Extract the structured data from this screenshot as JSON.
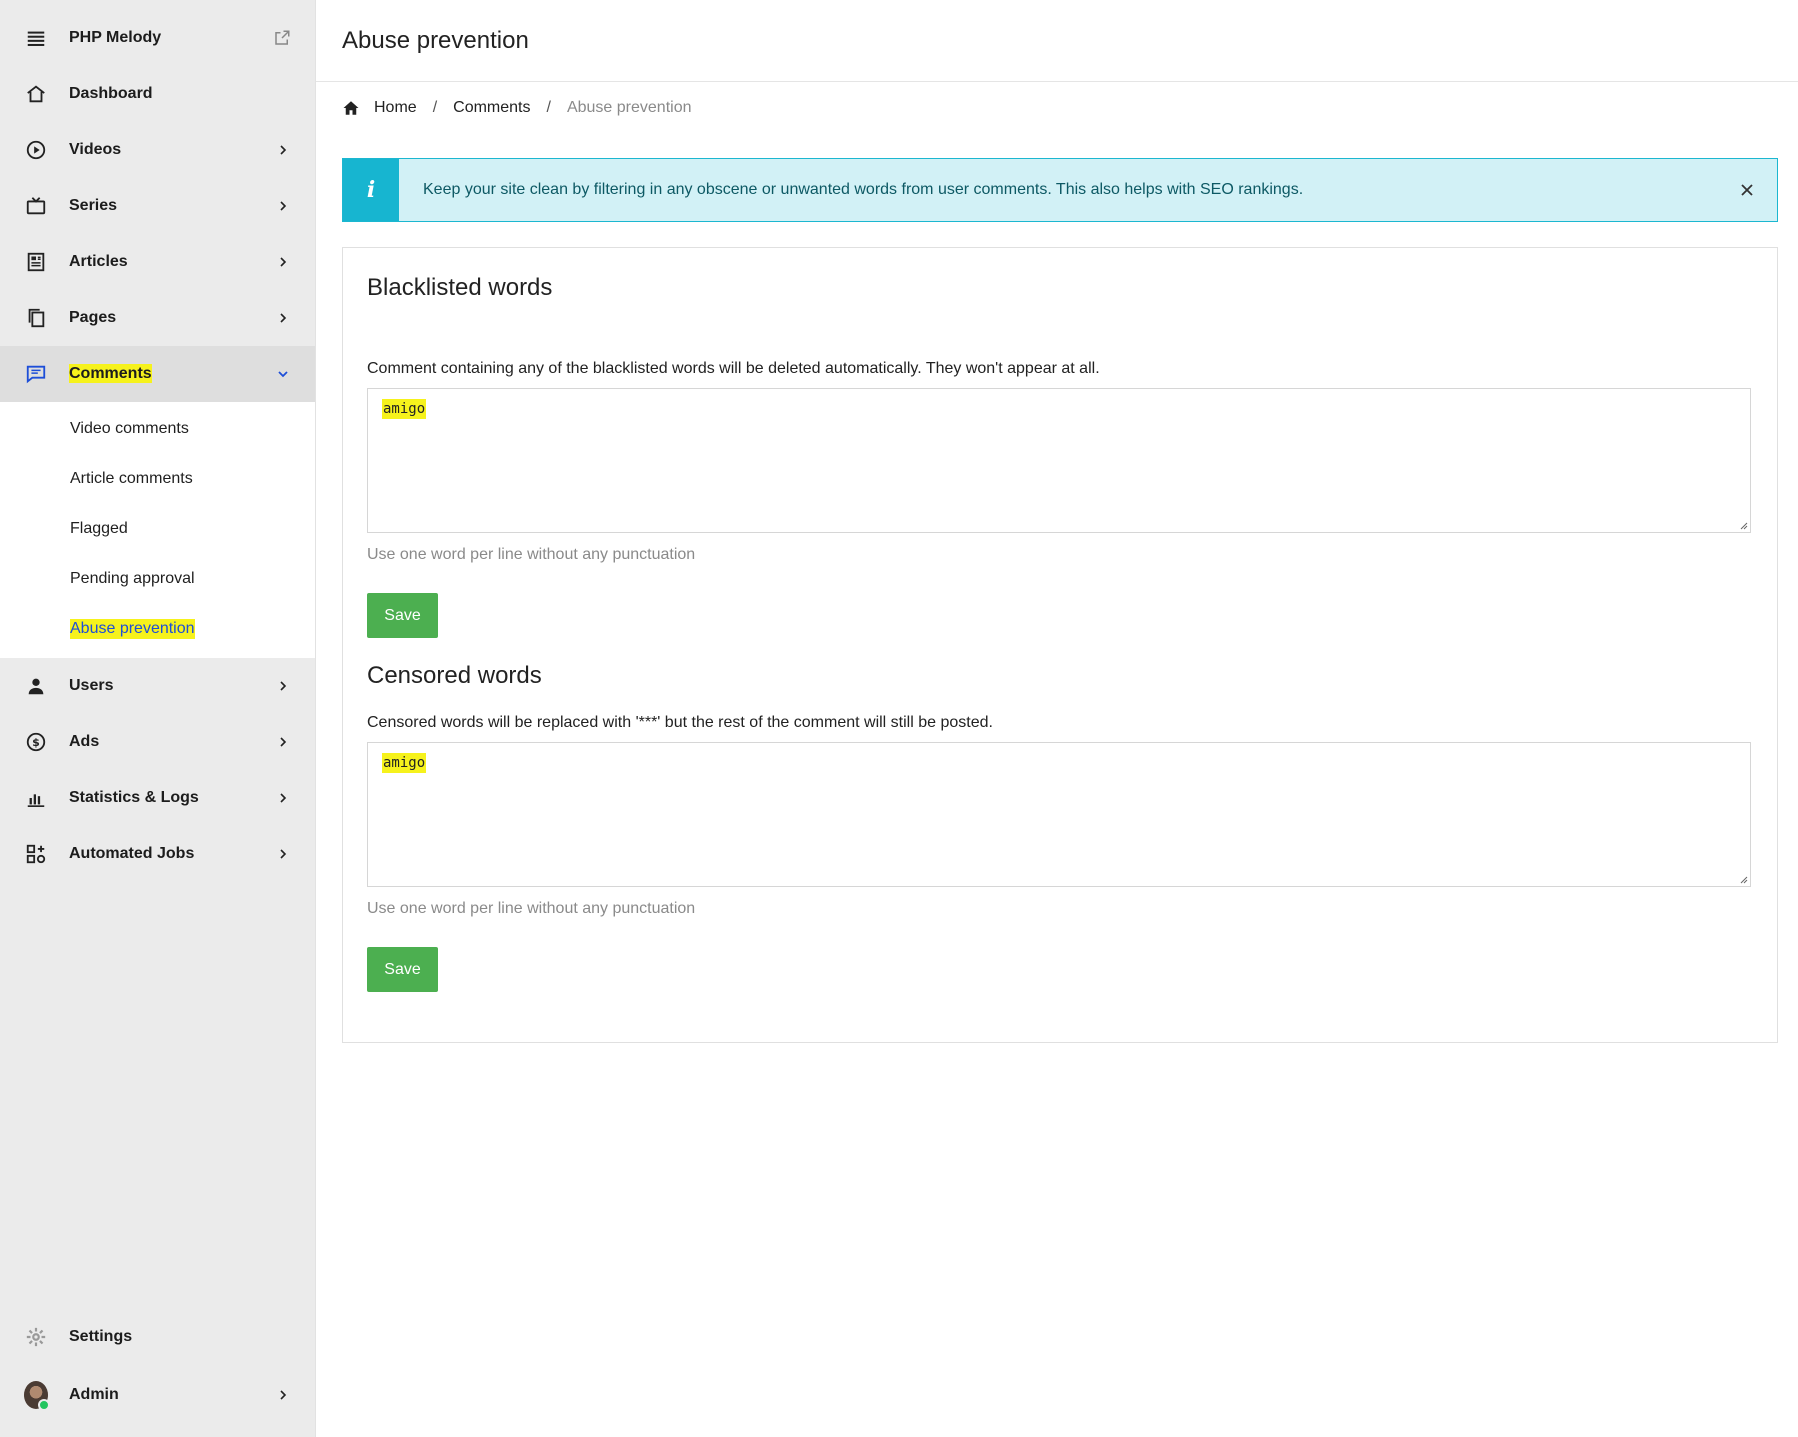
{
  "sidebar": {
    "brand": "PHP Melody",
    "items": [
      {
        "label": "Dashboard"
      },
      {
        "label": "Videos"
      },
      {
        "label": "Series"
      },
      {
        "label": "Articles"
      },
      {
        "label": "Pages"
      },
      {
        "label": "Comments"
      },
      {
        "label": "Users"
      },
      {
        "label": "Ads"
      },
      {
        "label": "Statistics & Logs"
      },
      {
        "label": "Automated Jobs"
      }
    ],
    "submenu": [
      {
        "label": "Video comments"
      },
      {
        "label": "Article comments"
      },
      {
        "label": "Flagged"
      },
      {
        "label": "Pending approval"
      },
      {
        "label": "Abuse prevention"
      }
    ],
    "settings": "Settings",
    "admin": "Admin",
    "colors": {
      "highlight": "#f6f21c",
      "active_link": "#1d4ed8"
    }
  },
  "header": {
    "title": "Abuse prevention"
  },
  "breadcrumb": {
    "home": "Home",
    "sep1": "/",
    "comments": "Comments",
    "sep2": "/",
    "current": "Abuse prevention"
  },
  "alert": {
    "icon": "i",
    "text": "Keep your site clean by filtering in any obscene or unwanted words from user comments. This also helps with SEO rankings.",
    "color": "#17b5d0"
  },
  "blacklist": {
    "title": "Blacklisted words",
    "description": "Comment containing any of the blacklisted words will be deleted automatically. They won't appear at all.",
    "value": "amigo",
    "help": "Use one word per line without any punctuation",
    "save_label": "Save"
  },
  "censored": {
    "title": "Censored words",
    "description": "Censored words will be replaced with '***' but the rest of the comment will still be posted.",
    "value": "amigo",
    "help": "Use one word per line without any punctuation",
    "save_label": "Save"
  },
  "button_color": "#4caf50"
}
